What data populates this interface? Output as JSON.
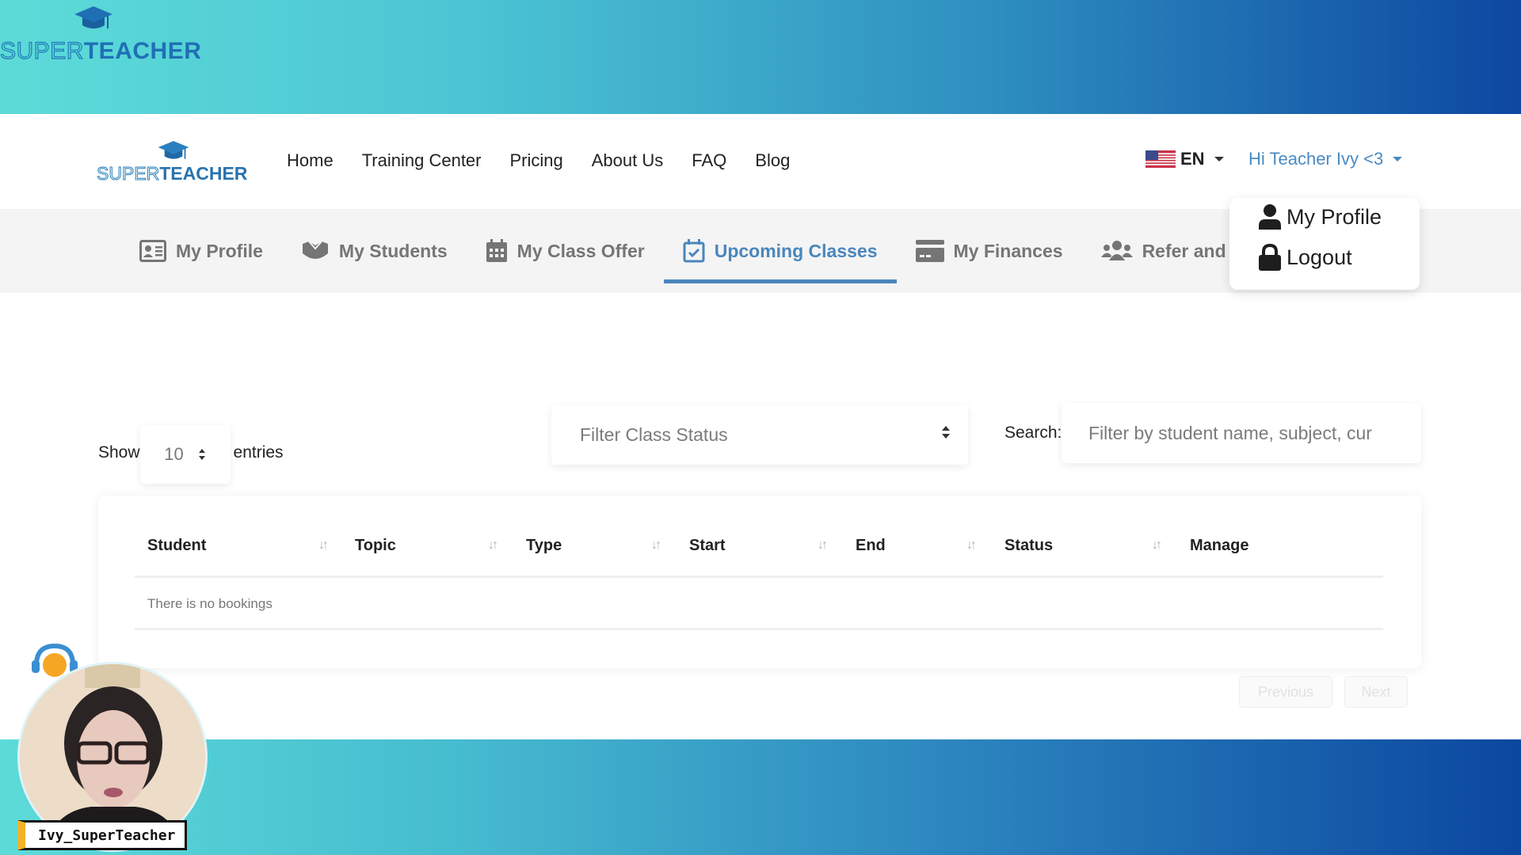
{
  "brand": {
    "name_part1": "SUPER",
    "name_part2": "TEACHER",
    "colors": {
      "primary": "#1f6fb5",
      "accent": "#4a86bd",
      "gradient_start": "#5ddbd8",
      "gradient_end": "#0d47a1"
    }
  },
  "navbar": {
    "links": [
      "Home",
      "Training Center",
      "Pricing",
      "About Us",
      "FAQ",
      "Blog"
    ],
    "language": {
      "code": "EN",
      "flag_icon": "us-flag-icon"
    },
    "user_greeting": "Hi Teacher Ivy <3"
  },
  "user_dropdown": {
    "items": [
      {
        "label": "My Profile",
        "icon": "user-icon"
      },
      {
        "label": "Logout",
        "icon": "lock-icon"
      }
    ]
  },
  "tabs": [
    {
      "label": "My Profile",
      "icon": "id-card-icon",
      "active": false
    },
    {
      "label": "My Students",
      "icon": "students-icon",
      "active": false
    },
    {
      "label": "My Class Offer",
      "icon": "calendar-icon",
      "active": false
    },
    {
      "label": "Upcoming Classes",
      "icon": "calendar-check-icon",
      "active": true
    },
    {
      "label": "My Finances",
      "icon": "credit-card-icon",
      "active": false
    },
    {
      "label": "Refer and Ea",
      "icon": "users-icon",
      "active": false
    }
  ],
  "controls": {
    "show_label": "Show",
    "entries_value": "10",
    "entries_label": "entries",
    "status_filter_placeholder": "Filter Class Status",
    "search_label": "Search:",
    "search_placeholder": "Filter by student name, subject, cur",
    "search_value": ""
  },
  "table": {
    "columns": [
      "Student",
      "Topic",
      "Type",
      "Start",
      "End",
      "Status",
      "Manage"
    ],
    "empty_message": "There is no bookings"
  },
  "pagination": {
    "previous": "Previous",
    "next": "Next"
  },
  "webcam": {
    "name": "Ivy_SuperTeacher"
  }
}
